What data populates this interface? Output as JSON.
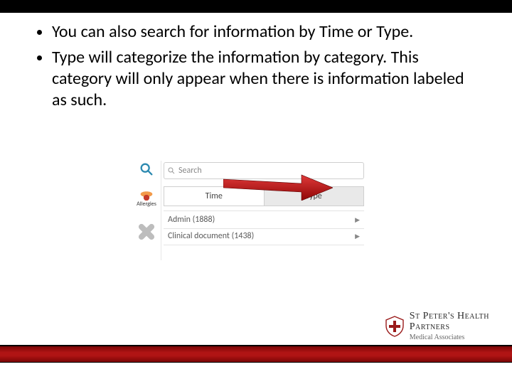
{
  "bullets": [
    "You can also search for information by Time or Type.",
    "Type will categorize the information by category. This category will only appear when there is information labeled as such."
  ],
  "screenshot": {
    "search": {
      "placeholder": "Search"
    },
    "tabs": {
      "time": "Time",
      "type": "Type"
    },
    "sidebar": {
      "allergies_label": "Allergies"
    },
    "categories": [
      {
        "label": "Admin (1888)"
      },
      {
        "label": "Clinical document (1438)"
      }
    ]
  },
  "brand": {
    "name": "St Peter's Health",
    "line2": "Partners",
    "sub": "Medical Associates"
  }
}
